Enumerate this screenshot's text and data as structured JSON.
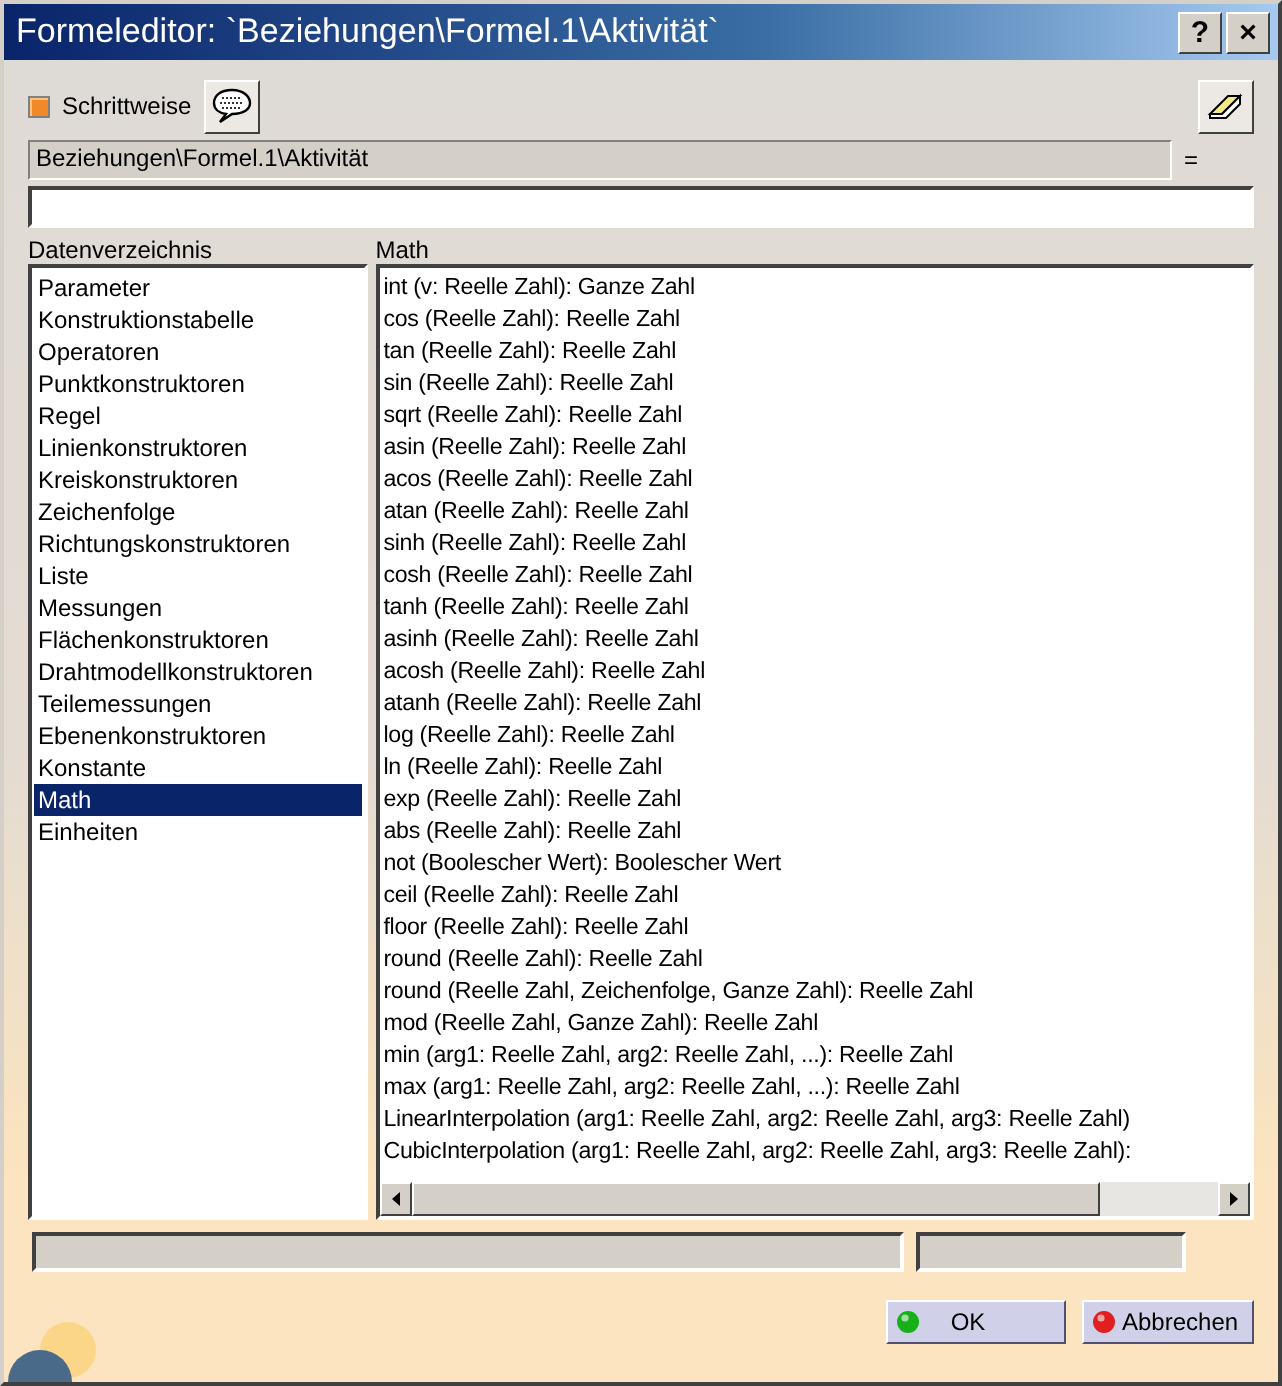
{
  "window": {
    "title": "Formeleditor:  `Beziehungen\\Formel.1\\Aktivität`",
    "help_button": "?",
    "close_button": "×"
  },
  "toolbar": {
    "stepwise": {
      "label": "Schrittweise",
      "checked": true
    }
  },
  "formula": {
    "target": "Beziehungen\\Formel.1\\Aktivität",
    "equals": "="
  },
  "directory": {
    "label": "Datenverzeichnis",
    "items": [
      {
        "label": "Parameter",
        "selected": false
      },
      {
        "label": "Konstruktionstabelle",
        "selected": false
      },
      {
        "label": "Operatoren",
        "selected": false
      },
      {
        "label": "Punktkonstruktoren",
        "selected": false
      },
      {
        "label": "Regel",
        "selected": false
      },
      {
        "label": "Linienkonstruktoren",
        "selected": false
      },
      {
        "label": "Kreiskonstruktoren",
        "selected": false
      },
      {
        "label": "Zeichenfolge",
        "selected": false
      },
      {
        "label": "Richtungskonstruktoren",
        "selected": false
      },
      {
        "label": "Liste",
        "selected": false
      },
      {
        "label": "Messungen",
        "selected": false
      },
      {
        "label": "Flächenkonstruktoren",
        "selected": false
      },
      {
        "label": "Drahtmodellkonstruktoren",
        "selected": false
      },
      {
        "label": "Teilemessungen",
        "selected": false
      },
      {
        "label": "Ebenenkonstruktoren",
        "selected": false
      },
      {
        "label": "Konstante",
        "selected": false
      },
      {
        "label": "Math",
        "selected": true
      },
      {
        "label": "Einheiten",
        "selected": false
      }
    ]
  },
  "members": {
    "label": "Math",
    "items": [
      "int (v: Reelle Zahl): Ganze Zahl",
      "cos (Reelle Zahl): Reelle Zahl",
      "tan (Reelle Zahl): Reelle Zahl",
      "sin (Reelle Zahl): Reelle Zahl",
      "sqrt (Reelle Zahl): Reelle Zahl",
      "asin (Reelle Zahl): Reelle Zahl",
      "acos (Reelle Zahl): Reelle Zahl",
      "atan (Reelle Zahl): Reelle Zahl",
      "sinh (Reelle Zahl): Reelle Zahl",
      "cosh (Reelle Zahl): Reelle Zahl",
      "tanh (Reelle Zahl): Reelle Zahl",
      "asinh (Reelle Zahl): Reelle Zahl",
      "acosh (Reelle Zahl): Reelle Zahl",
      "atanh (Reelle Zahl): Reelle Zahl",
      "log (Reelle Zahl): Reelle Zahl",
      "ln (Reelle Zahl): Reelle Zahl",
      "exp (Reelle Zahl): Reelle Zahl",
      "abs (Reelle Zahl): Reelle Zahl",
      "not (Boolescher Wert): Boolescher Wert",
      "ceil (Reelle Zahl): Reelle Zahl",
      "floor (Reelle Zahl): Reelle Zahl",
      "round (Reelle Zahl): Reelle Zahl",
      "round (Reelle Zahl, Zeichenfolge, Ganze Zahl): Reelle Zahl",
      "mod (Reelle Zahl, Ganze Zahl): Reelle Zahl",
      "min (arg1: Reelle Zahl, arg2: Reelle Zahl, ...): Reelle Zahl",
      "max (arg1: Reelle Zahl, arg2: Reelle Zahl, ...): Reelle Zahl",
      "LinearInterpolation (arg1: Reelle Zahl, arg2: Reelle Zahl, arg3: Reelle Zahl)",
      "CubicInterpolation (arg1: Reelle Zahl, arg2: Reelle Zahl, arg3: Reelle Zahl):"
    ]
  },
  "buttons": [
    {
      "label": "OK",
      "kind": "ok"
    },
    {
      "label": "Abbrechen",
      "kind": "cancel"
    }
  ]
}
